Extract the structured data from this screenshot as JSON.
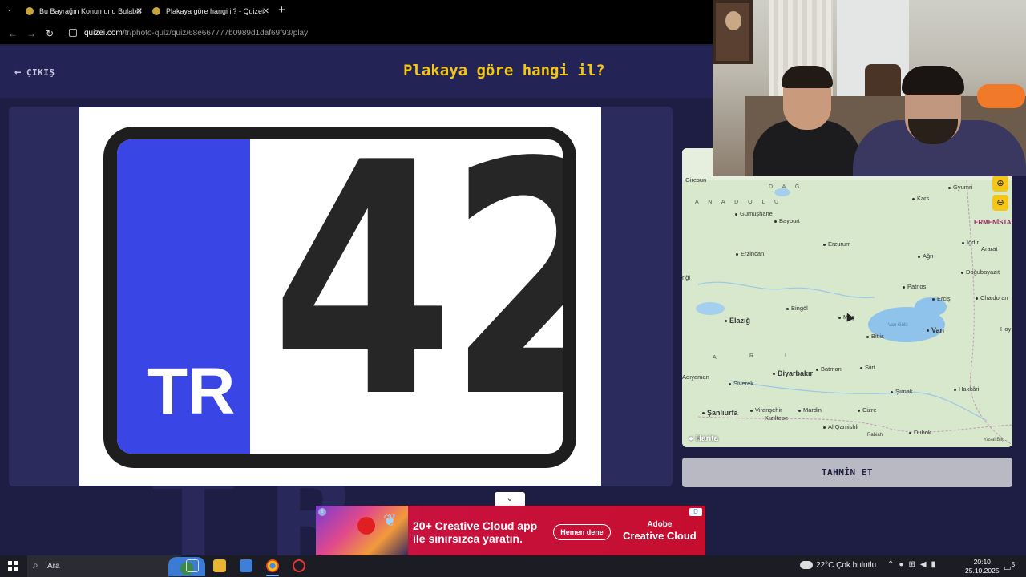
{
  "browser": {
    "tabs": [
      {
        "title": "Bu Bayrağın Konumunu Bulabili"
      },
      {
        "title": "Plakaya göre hangi il? - Quizei"
      }
    ],
    "url_host": "quizei.com",
    "url_path": "/tr/photo-quiz/quiz/68e667777b0989d1daf69f93/play"
  },
  "quiz": {
    "exit_label": "ÇIKIŞ",
    "title": "Plakaya göre hangi il?",
    "plate_country": "TR",
    "plate_number": "42",
    "background_text": "TR",
    "guess_button": "TAHMİN ET"
  },
  "map": {
    "brand": "Harita",
    "legal": "Yasal Bilg.",
    "region_labels": [
      "A N A D O L U",
      "D A Ğ",
      "A",
      "R",
      "I"
    ],
    "country_label": "ERMENİSTAN",
    "cities": [
      {
        "name": "Giresun"
      },
      {
        "name": "Gümüşhane"
      },
      {
        "name": "Bayburt"
      },
      {
        "name": "Kars"
      },
      {
        "name": "Gyumri"
      },
      {
        "name": "Erzincan"
      },
      {
        "name": "Erzurum"
      },
      {
        "name": "Iğdır"
      },
      {
        "name": "Ararat"
      },
      {
        "name": "Ağrı"
      },
      {
        "name": "Doğubayazıt"
      },
      {
        "name": "Patnos"
      },
      {
        "name": "Erciş"
      },
      {
        "name": "Chaldoran"
      },
      {
        "name": "Bingöl"
      },
      {
        "name": "Muş"
      },
      {
        "name": "Elazığ"
      },
      {
        "name": "Bitlis"
      },
      {
        "name": "Van"
      },
      {
        "name": "Hoy"
      },
      {
        "name": "Adıyaman"
      },
      {
        "name": "Diyarbakır"
      },
      {
        "name": "Batman"
      },
      {
        "name": "Siirt"
      },
      {
        "name": "Siverek"
      },
      {
        "name": "Şırnak"
      },
      {
        "name": "Hakkâri"
      },
      {
        "name": "Şanlıurfa"
      },
      {
        "name": "Viranşehir"
      },
      {
        "name": "Kızıltepe"
      },
      {
        "name": "Mardin"
      },
      {
        "name": "Cizre"
      },
      {
        "name": "Duhok"
      },
      {
        "name": "Al Qamishli"
      },
      {
        "name": "Rabiah"
      },
      {
        "name": "Van Gölü"
      },
      {
        "name": "riği"
      }
    ]
  },
  "ad": {
    "line1": "20+ Creative Cloud app",
    "line2": "ile sınırsızca yaratın.",
    "cta": "Hemen dene",
    "brand_top": "Adobe",
    "brand": "Creative Cloud",
    "badge": "D"
  },
  "taskbar": {
    "search_placeholder": "Ara",
    "weather": "22°C  Çok bulutlu",
    "time": "20:10",
    "date": "25.10.2025",
    "notif_count": "5"
  },
  "colors": {
    "accent": "#f5c518",
    "page_bg": "#1e1d44",
    "plate_blue": "#3a45e6"
  },
  "icons": {
    "exit": "arrow-left-icon",
    "zoom_in": "zoom-in-icon",
    "zoom_out": "zoom-out-icon",
    "collapse": "chevron-down-icon"
  }
}
